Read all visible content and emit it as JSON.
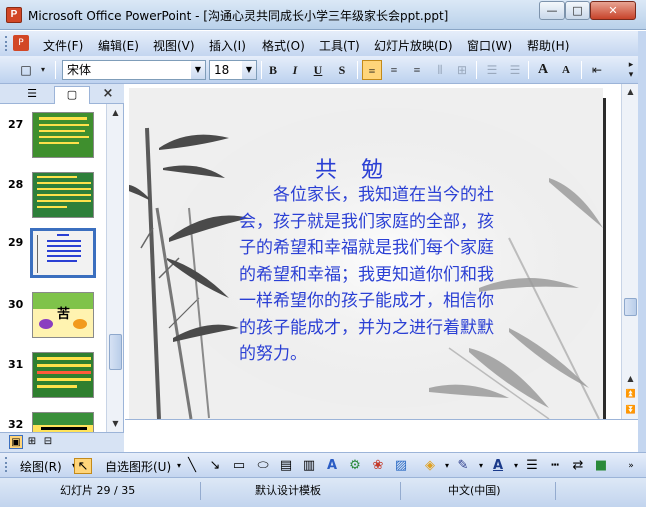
{
  "window": {
    "title": "Microsoft Office PowerPoint - [沟通心灵共同成长小学三年级家长会ppt.ppt]",
    "app_icon": "P",
    "minimize": "—",
    "maximize": "□",
    "close": "✕"
  },
  "menu": {
    "items": [
      {
        "label": "文件(F)"
      },
      {
        "label": "编辑(E)"
      },
      {
        "label": "视图(V)"
      },
      {
        "label": "插入(I)"
      },
      {
        "label": "格式(O)"
      },
      {
        "label": "工具(T)"
      },
      {
        "label": "幻灯片放映(D)"
      },
      {
        "label": "窗口(W)"
      },
      {
        "label": "帮助(H)"
      }
    ]
  },
  "toolbar": {
    "font_name": "宋体",
    "font_size": "18",
    "bold": "B",
    "italic": "I",
    "underline": "U",
    "shadow": "S",
    "align_left": "≡",
    "align_center": "≡",
    "align_right": "≡",
    "distribute": "⊞",
    "numbering": "☰",
    "bullets": "☰",
    "grow_font": "A",
    "shrink_font": "A",
    "decrease_indent": "⇤"
  },
  "outline_tabs": {
    "outline_tab": "☰",
    "slides_tab": "▢",
    "close": "×"
  },
  "thumbnails": [
    {
      "number": "27",
      "bg": "#3f8f2e",
      "selected": false
    },
    {
      "number": "28",
      "bg": "#2e7f3a",
      "selected": false
    },
    {
      "number": "29",
      "bg": "#f2f2f2",
      "selected": true
    },
    {
      "number": "30",
      "bg": "#ffd84a",
      "selected": false,
      "caption": "苦"
    },
    {
      "number": "31",
      "bg": "#2f7f2f",
      "selected": false
    },
    {
      "number": "32",
      "bg": "#ffe35a",
      "selected": false
    }
  ],
  "slide": {
    "title": "共勉",
    "body": "　　各位家长，我知道在当今的社会，孩子就是我们家庭的全部，孩子的希望和幸福就是我们每个家庭的希望和幸福；我更知道你们和我一样希望你的孩子能成才，相信你的孩子能成才，并为之进行着默默的努力。",
    "text_color": "#2a3fd4"
  },
  "drawing_toolbar": {
    "draw_label": "绘图(R)",
    "autoshapes_label": "自选图形(U)"
  },
  "status": {
    "slide_info": "幻灯片 29 / 35",
    "design": "默认设计模板",
    "language": "中文(中国)"
  }
}
